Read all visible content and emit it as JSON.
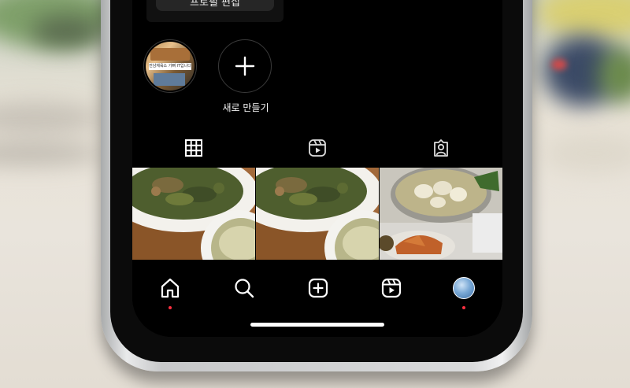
{
  "profile": {
    "top_button_label": "프로필 편집"
  },
  "highlights": [
    {
      "label": "",
      "cover_text": "전남체육소 기뻐 IT입니다"
    },
    {
      "label": "새로 만들기",
      "icon": "plus-icon"
    }
  ],
  "tabs": [
    {
      "name": "posts-grid",
      "icon": "grid-icon"
    },
    {
      "name": "reels",
      "icon": "reels-icon"
    },
    {
      "name": "tagged",
      "icon": "tagged-person-icon"
    }
  ],
  "posts": [
    {
      "description": "salad-plate-with-soup"
    },
    {
      "description": "salad-plate-with-soup"
    },
    {
      "description": "hotpot-and-grilled-shrimp"
    }
  ],
  "bottom_nav": [
    {
      "name": "home",
      "icon": "home-icon",
      "notification_dot": true
    },
    {
      "name": "search",
      "icon": "search-icon",
      "notification_dot": false
    },
    {
      "name": "new-post",
      "icon": "add-post-icon",
      "notification_dot": false
    },
    {
      "name": "reels",
      "icon": "reels-icon",
      "notification_dot": false
    },
    {
      "name": "profile",
      "icon": "avatar",
      "notification_dot": true
    }
  ],
  "colors": {
    "background": "#000000",
    "text": "#f5f5f5",
    "notification_dot": "#ff3040"
  }
}
